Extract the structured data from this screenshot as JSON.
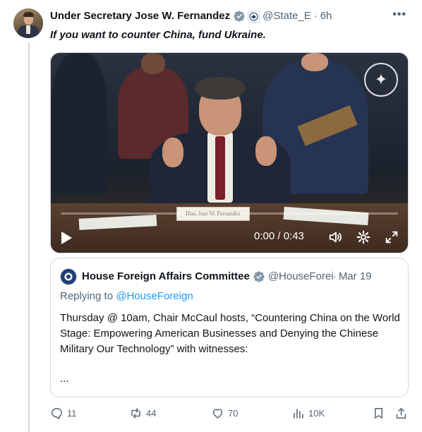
{
  "tweet": {
    "author_name": "Under Secretary Jose W. Fernandez",
    "author_handle": "@State_E",
    "separator": "·",
    "time": "6h",
    "text": "If you want to counter China, fund Ukraine.",
    "avatar_icon": "profile-photo",
    "verified_icon": "verified-badge-icon",
    "gov_icon": "government-seal-icon"
  },
  "video": {
    "time_display": "0:00 / 0:43",
    "progress_fraction": 0,
    "nameplate_text": "Hon. Jose W. Fernandez",
    "icons": [
      "play-icon",
      "volume-icon",
      "settings-icon",
      "fullscreen-icon",
      "state-department-seal-icon"
    ]
  },
  "quote": {
    "author_name": "House Foreign Affairs Committee",
    "author_handle": "@HouseForeign",
    "separator": "·",
    "date": "Mar 19",
    "replying_prefix": "Replying to ",
    "replying_handle": "@HouseForeign",
    "text": "Thursday @ 10am, Chair McCaul hosts, “Countering China on the World Stage: Empowering American Businesses and Denying the Chinese Military Our Technology” with witnesses:",
    "ellipsis": "..."
  },
  "actions": {
    "replies": "11",
    "reposts": "44",
    "likes": "70",
    "views": "10K"
  },
  "colors": {
    "text_primary": "#0f1419",
    "text_secondary": "#536471",
    "accent": "#1d9bf0",
    "border": "#cfd9de"
  }
}
